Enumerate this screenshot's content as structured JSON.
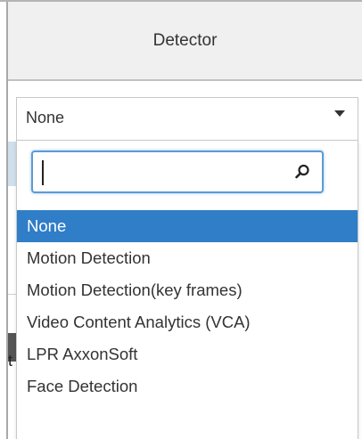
{
  "header": {
    "title": "Detector"
  },
  "select": {
    "value": "None"
  },
  "dropdown": {
    "search_value": "",
    "options": [
      {
        "label": "None",
        "selected": true
      },
      {
        "label": "Motion Detection",
        "selected": false
      },
      {
        "label": "Motion Detection(key frames)",
        "selected": false
      },
      {
        "label": "Video Content Analytics (VCA)",
        "selected": false
      },
      {
        "label": "LPR AxxonSoft",
        "selected": false
      },
      {
        "label": "Face Detection",
        "selected": false
      }
    ]
  },
  "background": {
    "partial_glyph": "t"
  },
  "colors": {
    "selected_bg": "#2f7ec7",
    "focus_border": "#5b9bd5",
    "header_bg": "#f0f0f0"
  },
  "icons": {
    "search": "search-icon",
    "dropdown_arrow": "chevron-down-icon"
  }
}
